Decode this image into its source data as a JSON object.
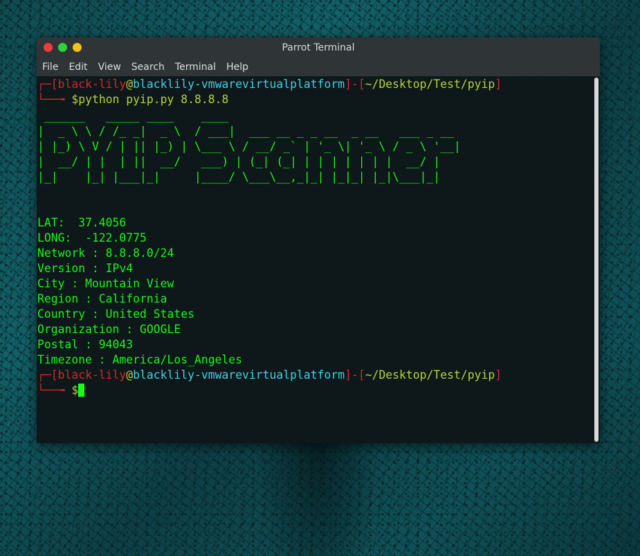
{
  "window": {
    "title": "Parrot Terminal"
  },
  "menu": [
    "File",
    "Edit",
    "View",
    "Search",
    "Terminal",
    "Help"
  ],
  "prompt": {
    "user": "black-lily",
    "at": "@",
    "host": "blacklily-vmwarevirtualplatform",
    "dash": "]-[",
    "path": "~/Desktop/Test/pyip",
    "close": "]",
    "top_corner": "┌─[",
    "bottom_corner": "└──╼",
    "symbol": "$"
  },
  "command": "python pyip.py 8.8.8.8",
  "banner": [
    " ______   _____ ____    ____",
    "|  _ \\ \\ / /_ _|  _ \\  / ___|  ___ __ _ _ __  _ __   ___ _ __",
    "| |_) \\ V / | || |_) | \\___ \\ / __/ _` | '_ \\| '_ \\ / _ \\ '__|",
    "|  __/ | |  | ||  __/   ___) | (_| (_| | | | | | | |  __/ |",
    "|_|    |_| |___|_|     |____/ \\___\\__,_|_| |_|_| |_|\\___|_|"
  ],
  "output": [
    "LAT:  37.4056",
    "LONG:  -122.0775",
    "Network : 8.8.8.0/24",
    "Version : IPv4",
    "City : Mountain View",
    "Region : California",
    "Country : United States",
    "Organization : GOOGLE",
    "Postal : 94043",
    "Timezone : America/Los_Angeles"
  ],
  "colors": {
    "output": "#19f51a",
    "bracket": "#d02a2a",
    "host": "#3bd3e6",
    "path": "#b3d43a"
  }
}
